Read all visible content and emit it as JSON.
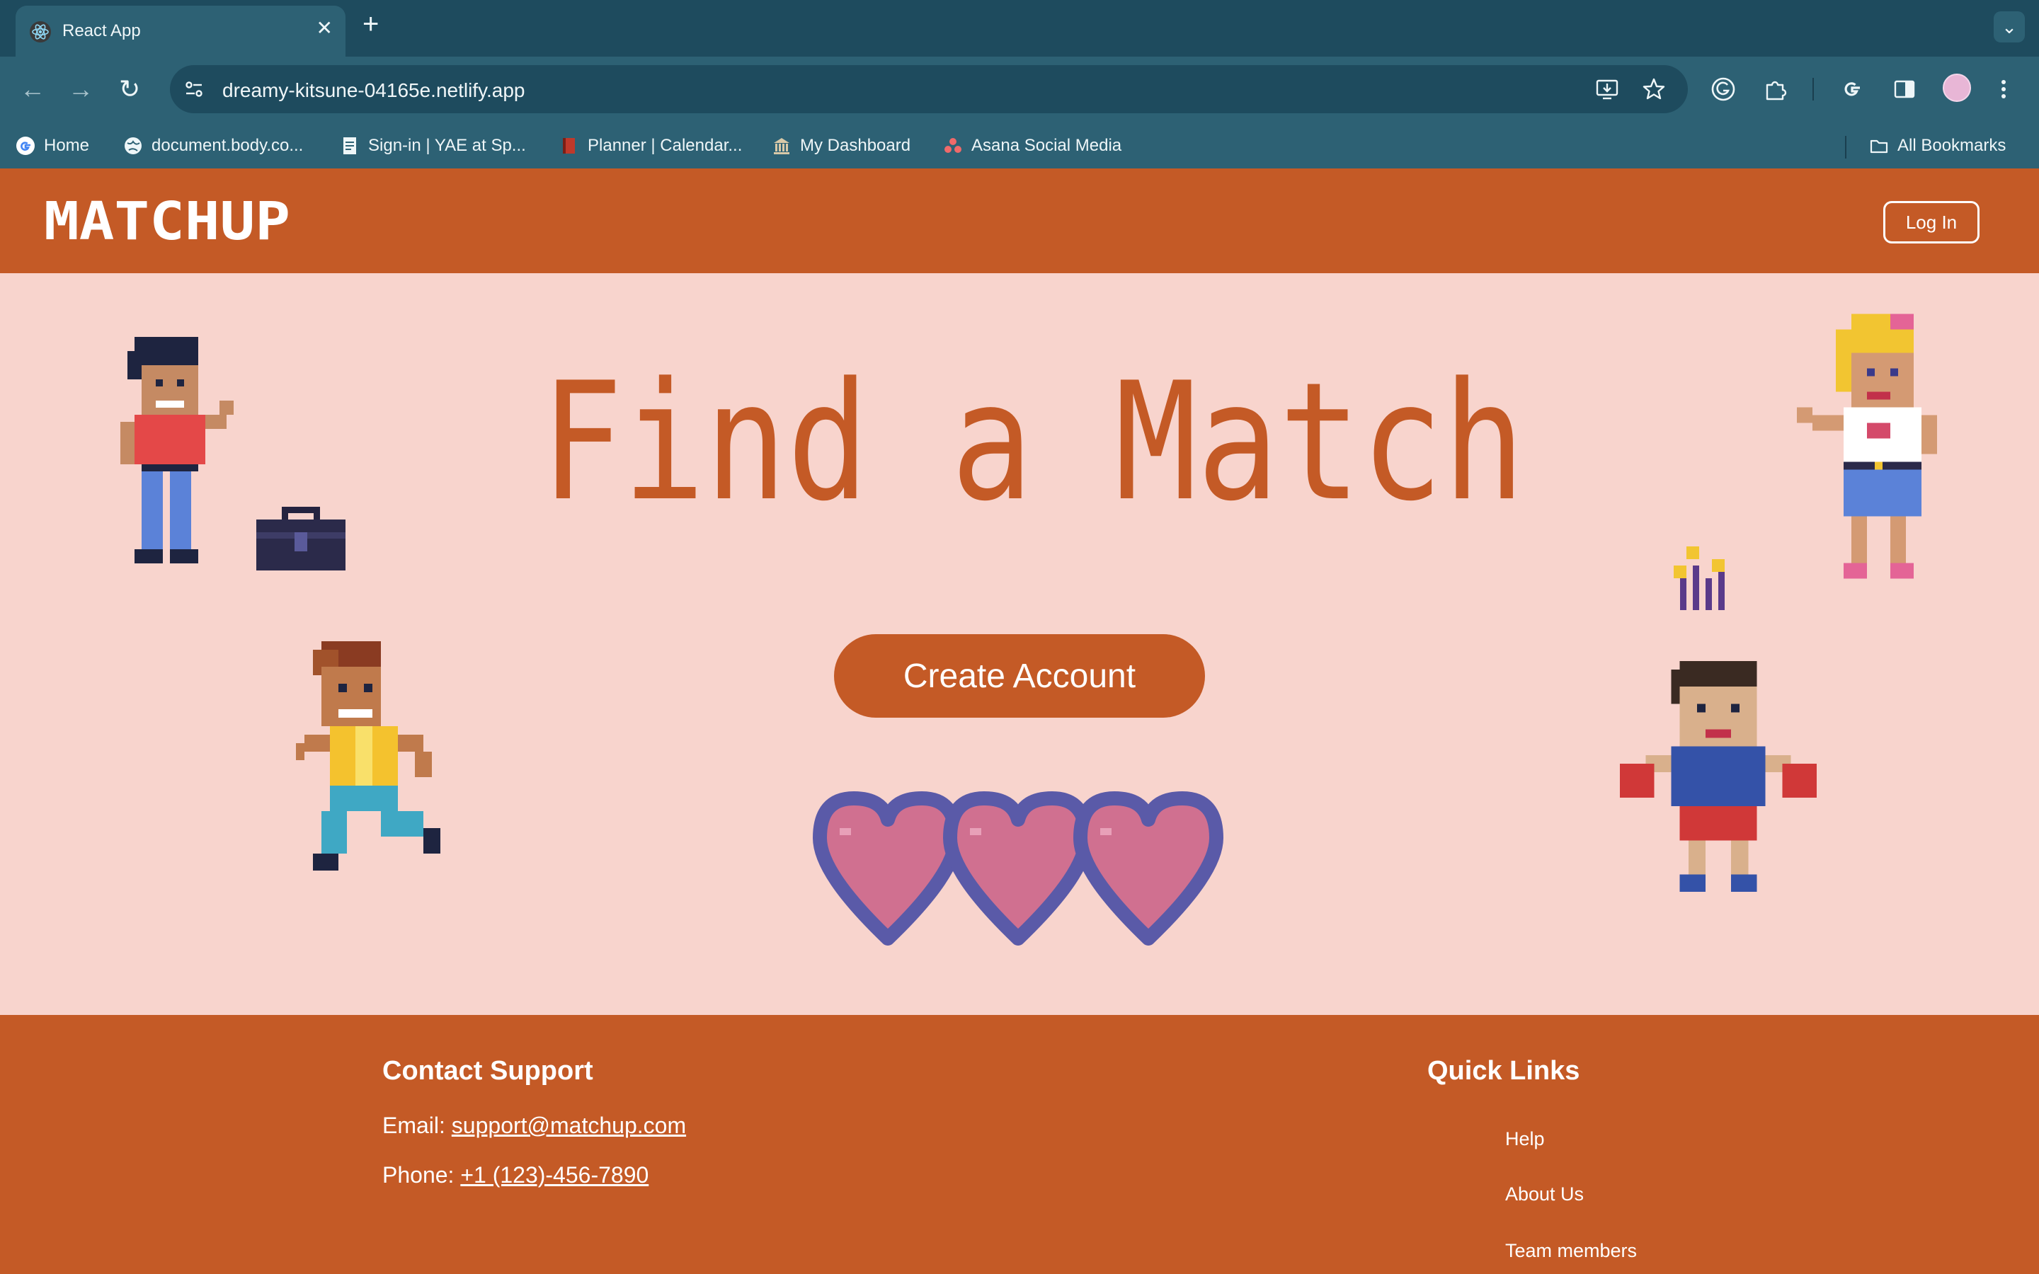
{
  "browser": {
    "tab_title": "React App",
    "tab_close": "✕",
    "new_tab": "+",
    "tab_menu": "⌄",
    "url": "dreamy-kitsune-04165e.netlify.app",
    "nav": {
      "back": "←",
      "forward": "→",
      "reload": "↻"
    },
    "bookmarks": [
      {
        "label": "Home",
        "icon": "google-icon"
      },
      {
        "label": "document.body.co...",
        "icon": "globe-icon"
      },
      {
        "label": "Sign-in | YAE at Sp...",
        "icon": "doc-icon"
      },
      {
        "label": "Planner | Calendar...",
        "icon": "book-icon"
      },
      {
        "label": "My Dashboard",
        "icon": "bank-icon"
      },
      {
        "label": "Asana Social Media",
        "icon": "asana-icon"
      }
    ],
    "all_bookmarks": "All Bookmarks",
    "colors": {
      "tabstrip": "#1e4b5e",
      "toolbar": "#2d6174"
    }
  },
  "site": {
    "logo": "MATCHUP",
    "login": "Log In",
    "hero_title": "Find a Match",
    "create_account": "Create Account",
    "footer": {
      "contact_heading": "Contact Support",
      "email_label": "Email: ",
      "email": "support@matchup.com",
      "phone_label": "Phone: ",
      "phone": "+1 (123)-456-7890",
      "quick_links_heading": "Quick Links",
      "links": [
        "Help",
        "About Us",
        "Team members"
      ]
    },
    "colors": {
      "primary": "#c45a26",
      "hero_bg": "#f8d4cd",
      "text_light": "#ffffff"
    }
  }
}
